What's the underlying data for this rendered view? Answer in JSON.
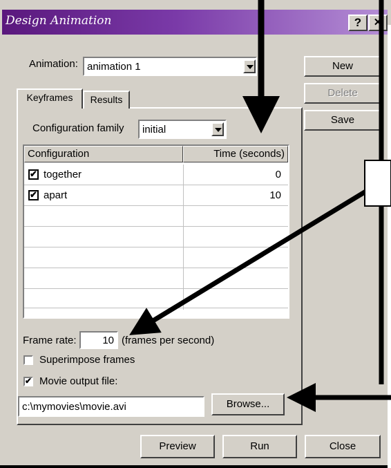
{
  "window": {
    "title": "Design Animation",
    "help_glyph": "?",
    "close_glyph": "✕"
  },
  "animation": {
    "label": "Animation:",
    "value": "animation 1"
  },
  "side_buttons": {
    "new": "New",
    "delete": "Delete",
    "save": "Save"
  },
  "tabs": [
    {
      "label": "Keyframes",
      "selected": true
    },
    {
      "label": "Results",
      "selected": false
    }
  ],
  "config_family": {
    "label": "Configuration family",
    "value": "initial"
  },
  "table": {
    "columns": [
      "Configuration",
      "Time (seconds)"
    ],
    "rows": [
      {
        "name": "together",
        "time": "0",
        "checked": true
      },
      {
        "name": "apart",
        "time": "10",
        "checked": true
      }
    ]
  },
  "frame_rate": {
    "label": "Frame rate:",
    "value": "10",
    "unit": "(frames per second)"
  },
  "superimpose": {
    "label": "Superimpose frames",
    "checked": false
  },
  "movie_output": {
    "label": "Movie output file:",
    "checked": true,
    "path": "c:\\mymovies\\movie.avi",
    "browse_label": "Browse..."
  },
  "bottom_buttons": {
    "preview": "Preview",
    "run": "Run",
    "close": "Close"
  },
  "colors": {
    "dialog_face": "#d4d0c8",
    "title_gradient_start": "#5a187d",
    "title_gradient_end": "#b58fd6",
    "annotation_arrows": "#000000"
  }
}
